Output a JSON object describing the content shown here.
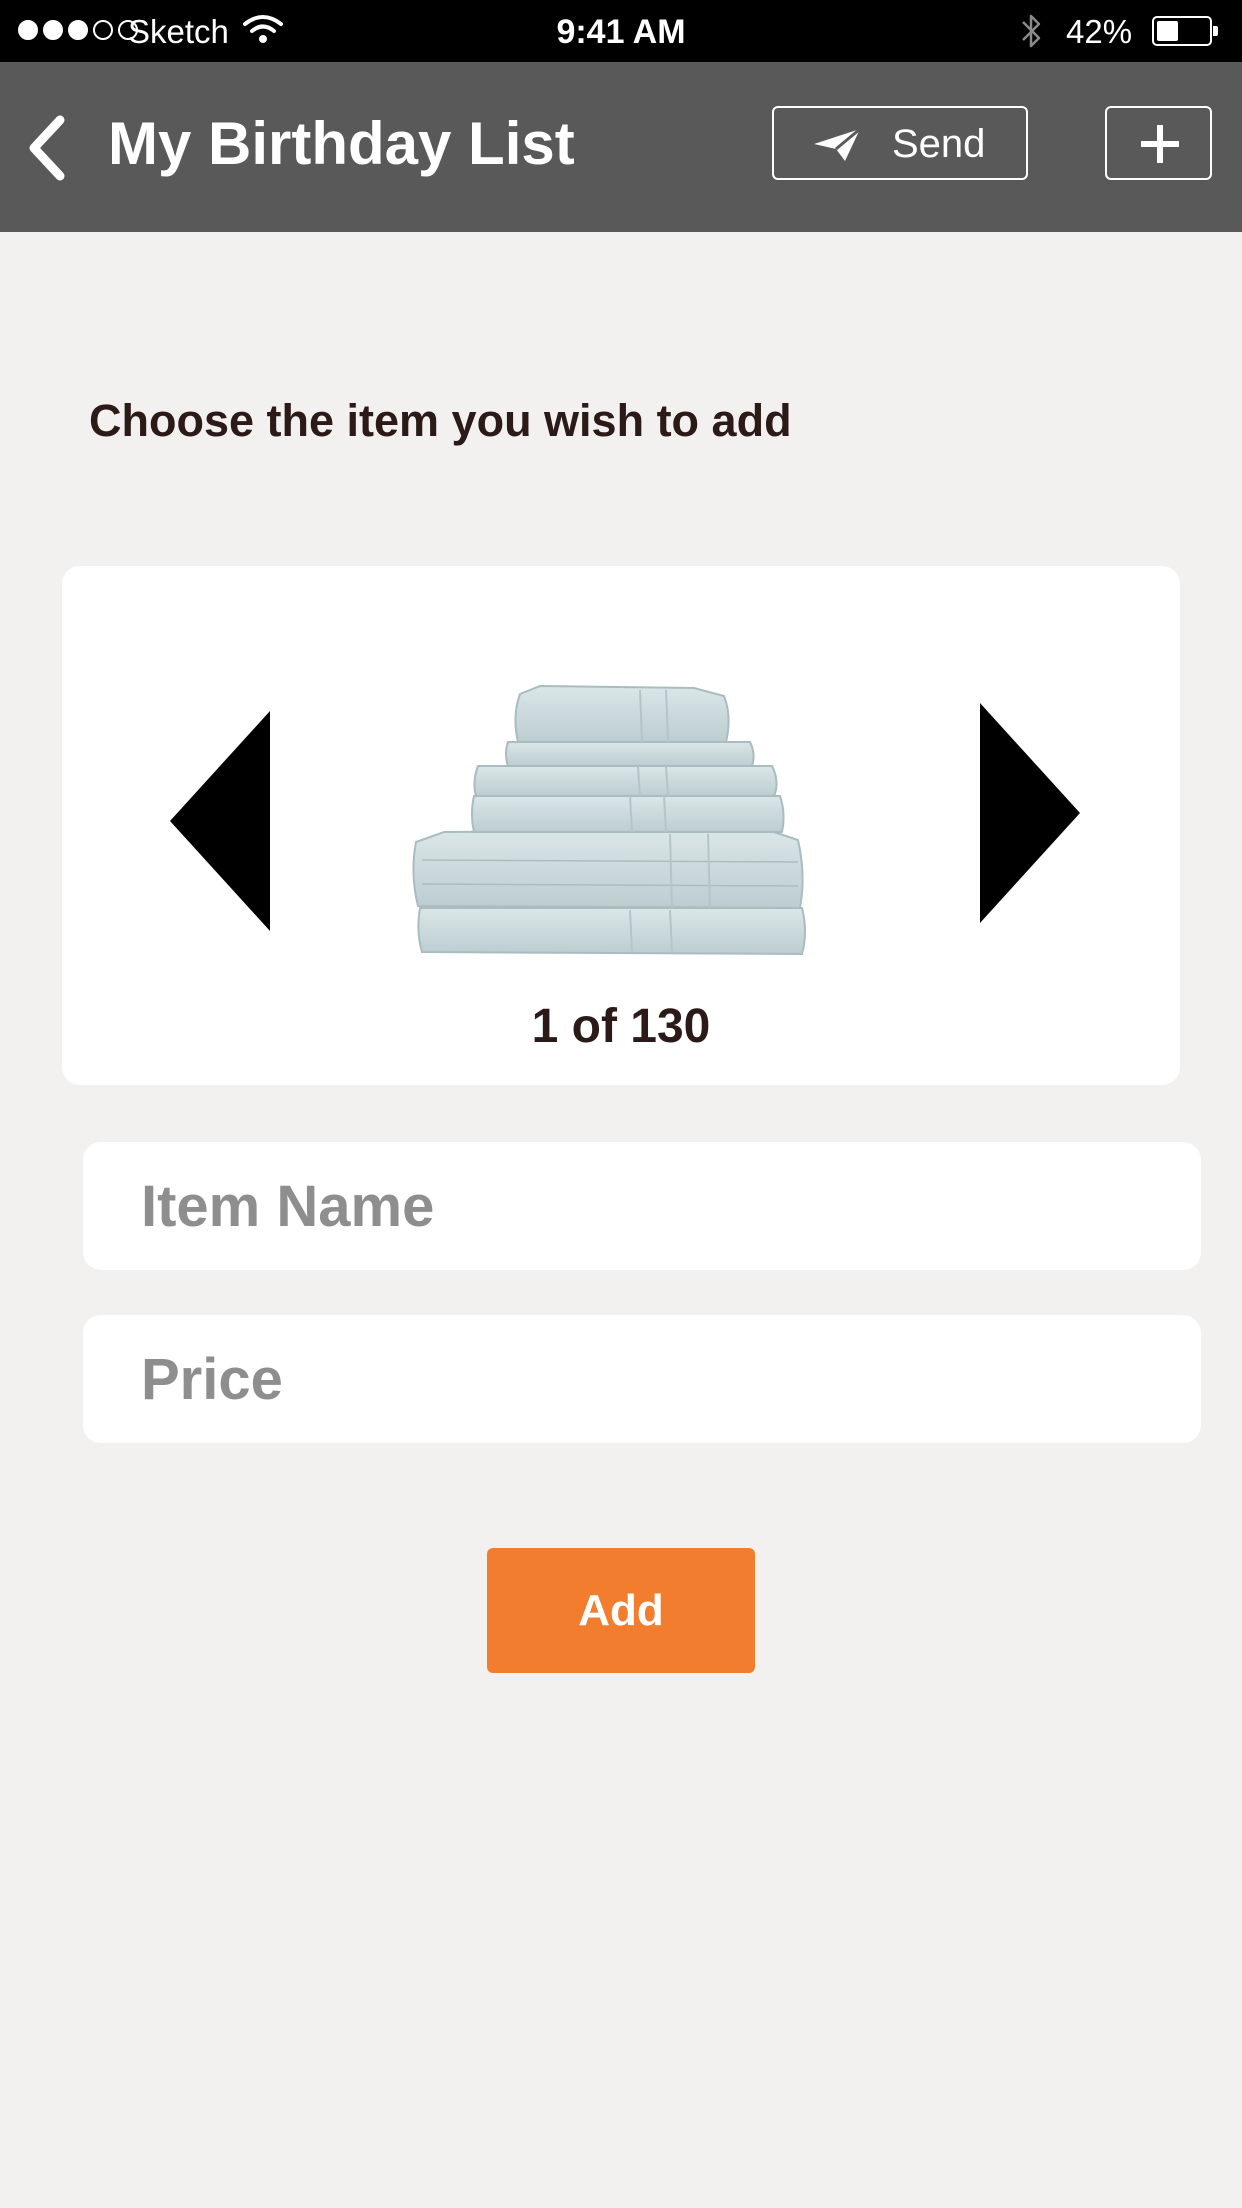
{
  "status_bar": {
    "carrier": "Sketch",
    "time": "9:41 AM",
    "battery_percent": "42%",
    "battery_level": 0.42,
    "signal_bars_filled": 3,
    "signal_bars_total": 5
  },
  "nav": {
    "title": "My Birthday List",
    "send_label": "Send",
    "back_icon": "chevron-left-icon",
    "send_icon": "paper-plane-icon",
    "add_icon": "plus-icon"
  },
  "main": {
    "heading": "Choose the item you wish to add",
    "carousel": {
      "counter": "1 of 130",
      "current_index": 1,
      "total": 130,
      "image": "stack-of-towels"
    },
    "item_name": {
      "placeholder": "Item Name",
      "value": ""
    },
    "price": {
      "placeholder": "Price",
      "value": ""
    },
    "add_label": "Add"
  },
  "colors": {
    "status_bar_bg": "#000000",
    "nav_bg": "#595959",
    "page_bg": "#f2f1ef",
    "accent": "#f27d2e",
    "heading_text": "#2b1a17",
    "placeholder_text": "#8e8e8e"
  }
}
